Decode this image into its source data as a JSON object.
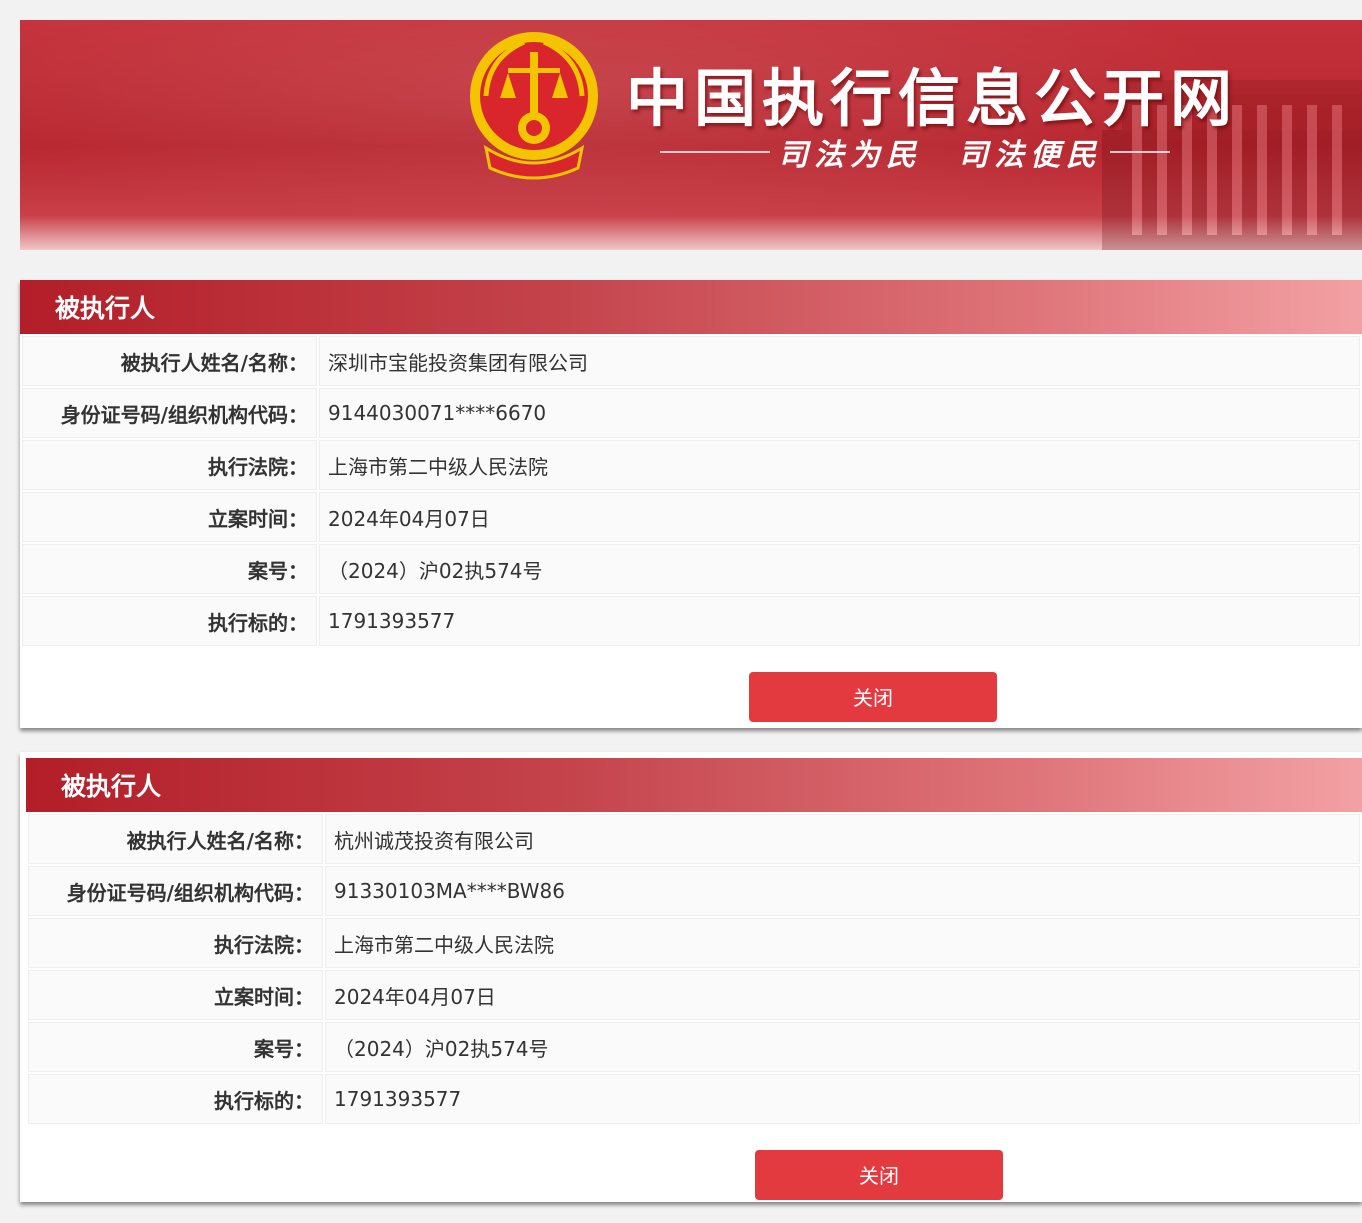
{
  "site": {
    "title": "中国执行信息公开网",
    "slogan": "司法为民　司法便民"
  },
  "records": [
    {
      "header": "被执行人",
      "rows": [
        {
          "label": "被执行人姓名/名称：",
          "value": "深圳市宝能投资集团有限公司"
        },
        {
          "label": "身份证号码/组织机构代码：",
          "value": "9144030071****6670"
        },
        {
          "label": "执行法院：",
          "value": "上海市第二中级人民法院"
        },
        {
          "label": "立案时间：",
          "value": "2024年04月07日"
        },
        {
          "label": "案号：",
          "value": "（2024）沪02执574号"
        },
        {
          "label": "执行标的：",
          "value": "1791393577"
        }
      ],
      "close_label": "关闭"
    },
    {
      "header": "被执行人",
      "rows": [
        {
          "label": "被执行人姓名/名称：",
          "value": "杭州诚茂投资有限公司"
        },
        {
          "label": "身份证号码/组织机构代码：",
          "value": "91330103MA****BW86"
        },
        {
          "label": "执行法院：",
          "value": "上海市第二中级人民法院"
        },
        {
          "label": "立案时间：",
          "value": "2024年04月07日"
        },
        {
          "label": "案号：",
          "value": "（2024）沪02执574号"
        },
        {
          "label": "执行标的：",
          "value": "1791393577"
        }
      ],
      "close_label": "关闭"
    }
  ],
  "colors": {
    "banner_red": "#b8252e",
    "button_red": "#e33a3f",
    "emblem_gold": "#f5c400"
  }
}
